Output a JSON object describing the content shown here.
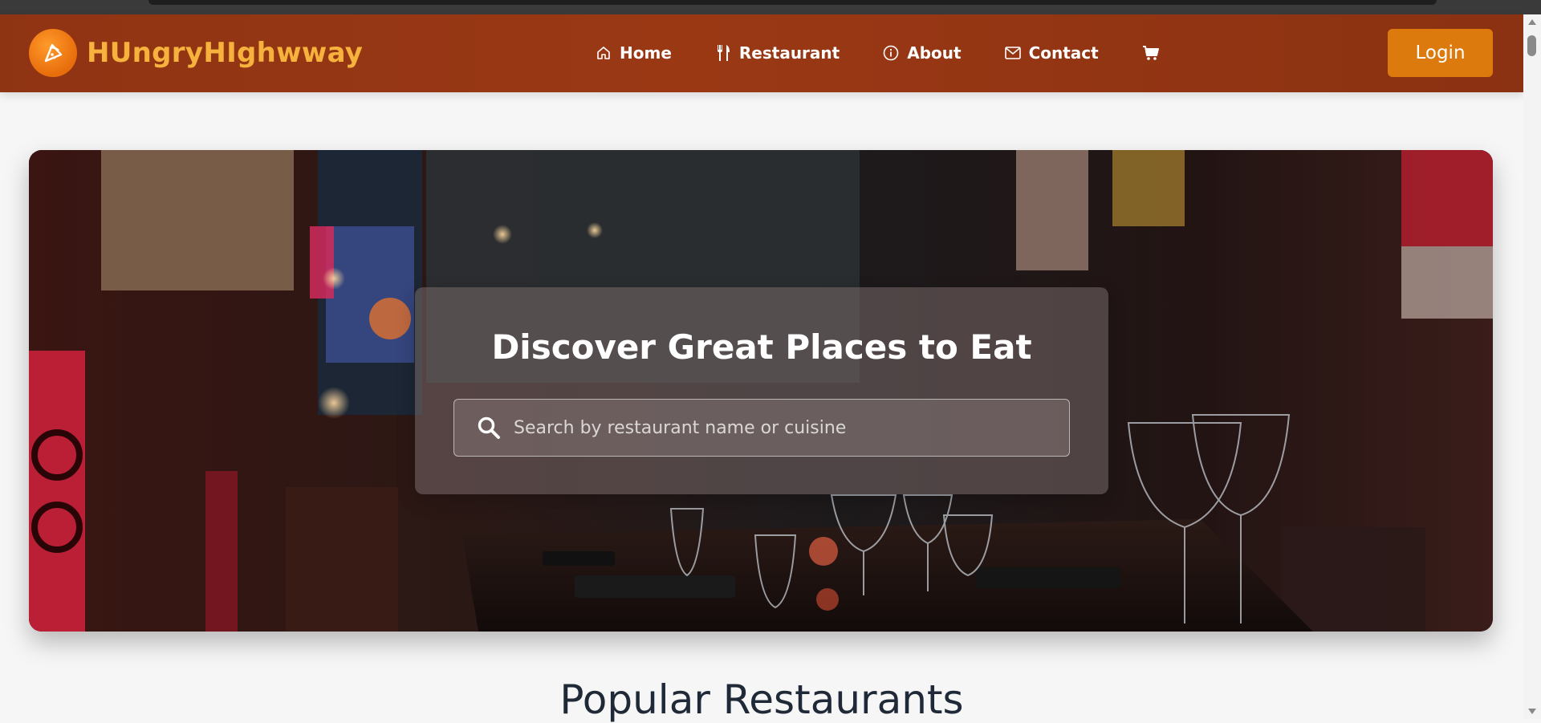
{
  "header": {
    "brand": "HUngryHIghwway",
    "nav": [
      {
        "label": "Home",
        "icon": "home-icon"
      },
      {
        "label": "Restaurant",
        "icon": "utensils-icon"
      },
      {
        "label": "About",
        "icon": "info-icon"
      },
      {
        "label": "Contact",
        "icon": "mail-icon"
      }
    ],
    "cart_icon": "cart-icon",
    "login_label": "Login"
  },
  "hero": {
    "title": "Discover Great Places to Eat",
    "search_placeholder": "Search by restaurant name or cuisine"
  },
  "popular": {
    "title": "Popular Restaurants"
  },
  "colors": {
    "nav_bg": "#963613",
    "brand_text": "#f6b23c",
    "accent": "#dd7a0d"
  }
}
